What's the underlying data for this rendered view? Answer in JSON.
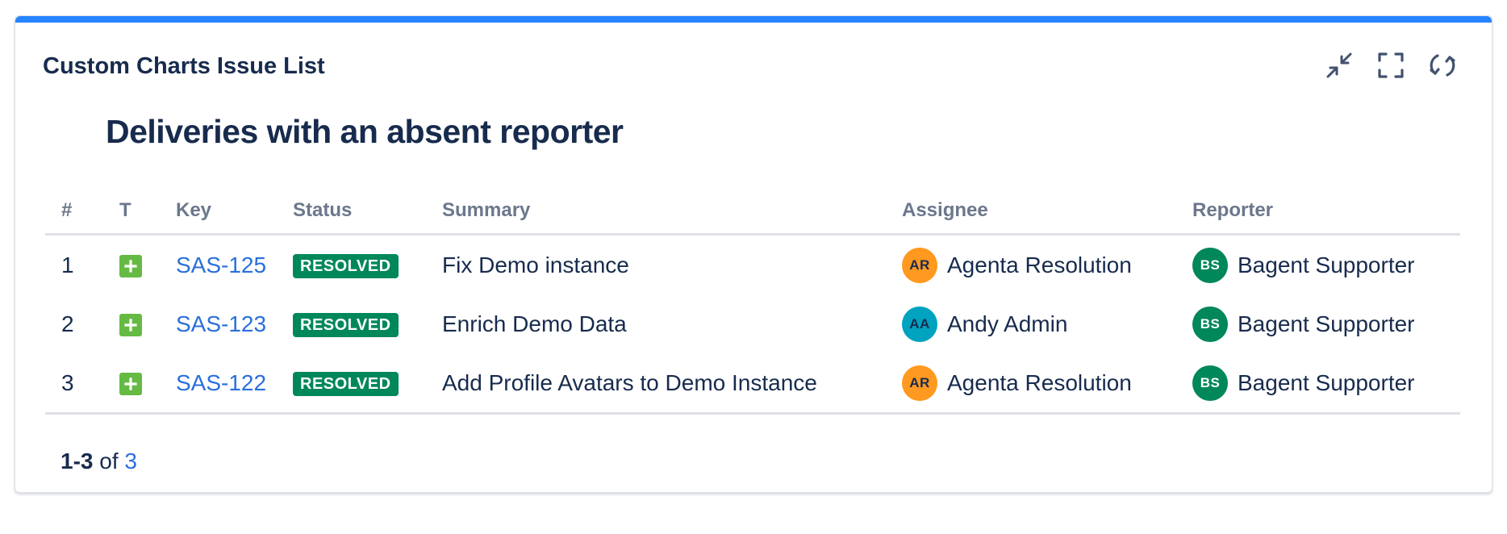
{
  "gadget": {
    "title": "Custom Charts Issue List",
    "accent_color": "#2684ff",
    "actions": [
      {
        "name": "minimize",
        "icon": "minimize-icon"
      },
      {
        "name": "fullscreen",
        "icon": "fullscreen-icon"
      },
      {
        "name": "refresh",
        "icon": "refresh-icon"
      }
    ]
  },
  "report": {
    "title": "Deliveries with an absent reporter"
  },
  "table": {
    "columns": {
      "num": "#",
      "type": "T",
      "key": "Key",
      "status": "Status",
      "summary": "Summary",
      "assignee": "Assignee",
      "reporter": "Reporter"
    },
    "rows": [
      {
        "num": "1",
        "type_icon": "new-feature-icon",
        "key": "SAS-125",
        "status": "RESOLVED",
        "summary": "Fix Demo instance",
        "assignee": {
          "initials": "AR",
          "name": "Agenta Resolution",
          "color": "#ff991f"
        },
        "reporter": {
          "initials": "BS",
          "name": "Bagent Supporter",
          "color": "#00875a"
        }
      },
      {
        "num": "2",
        "type_icon": "new-feature-icon",
        "key": "SAS-123",
        "status": "RESOLVED",
        "summary": "Enrich Demo Data",
        "assignee": {
          "initials": "AA",
          "name": "Andy Admin",
          "color": "#00a3bf"
        },
        "reporter": {
          "initials": "BS",
          "name": "Bagent Supporter",
          "color": "#00875a"
        }
      },
      {
        "num": "3",
        "type_icon": "new-feature-icon",
        "key": "SAS-122",
        "status": "RESOLVED",
        "summary": "Add Profile Avatars to Demo Instance",
        "assignee": {
          "initials": "AR",
          "name": "Agenta Resolution",
          "color": "#ff991f"
        },
        "reporter": {
          "initials": "BS",
          "name": "Bagent Supporter",
          "color": "#00875a"
        }
      }
    ]
  },
  "pager": {
    "range": "1-3",
    "of": "of",
    "total": "3"
  },
  "colors": {
    "status_resolved": "#00875a",
    "link": "#2a6fdb",
    "header_text": "#6b778c"
  }
}
